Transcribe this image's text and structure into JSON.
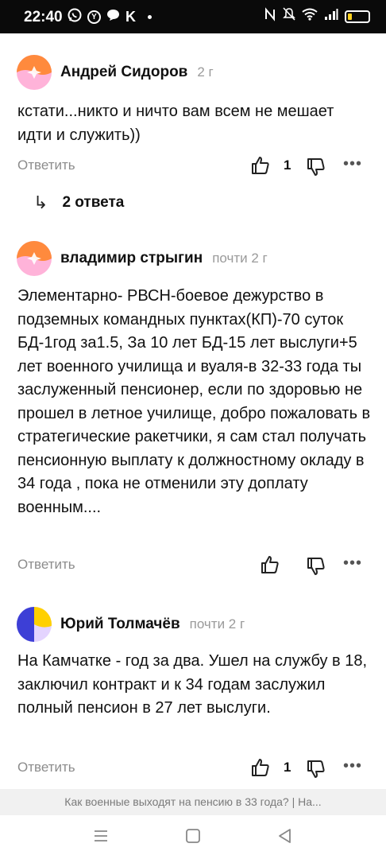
{
  "status_bar": {
    "time": "22:40",
    "notification_icons": [
      "whatsapp-icon",
      "yandex-icon",
      "chat-icon",
      "k-icon",
      "dot-icon"
    ],
    "system_icons": [
      "nfc-icon",
      "mute-icon",
      "wifi-icon",
      "signal-icon",
      "battery-icon"
    ],
    "battery_level": 0.2,
    "battery_color": "#ffd21f"
  },
  "comments": [
    {
      "author": "Андрей Сидоров",
      "age": "2 г",
      "text": "кстати...никто и ничто вам всем не мешает идти и служить))",
      "reply_label": "Ответить",
      "likes": "1",
      "replies_label": "2 ответа"
    },
    {
      "author": "владимир стрыгин",
      "age": "почти 2 г",
      "text": "Элементарно- РВСН-боевое дежурство в подземных командных пунктах(КП)-70 суток БД-1год за1.5, За 10 лет БД-15 лет выслуги+5 лет военного училища и вуаля-в 32-33 года ты заслуженный пенсионер, если по здоровью не прошел в летное училище, добро пожаловать в стратегические ракетчики, я сам стал получать пенсионную выплату к должностному окладу в 34 года , пока не отменили эту доплату военным....",
      "reply_label": "Ответить"
    },
    {
      "author": "Юрий Толмачёв",
      "age": "почти 2 г",
      "text": "На Камчатке - год за два. Ушел на службу в 18, заключил контракт и к 34 годам заслужил полный пенсион в 27 лет выслуги.",
      "reply_label": "Ответить",
      "likes": "1"
    }
  ],
  "page_title_bar": "Как военные выходят на пенсию в 33 года? | На...",
  "nav_bar": [
    "menu-icon",
    "home-icon",
    "back-icon"
  ],
  "colors": {
    "avatar_orange": "#ff8a3d",
    "avatar_pink": "#ffb3d9",
    "avatar_blue": "#3d3fd6",
    "avatar_yellow": "#ffd000",
    "avatar_lavender": "#e4d4ff",
    "secondary_text": "#8c8c8c"
  }
}
